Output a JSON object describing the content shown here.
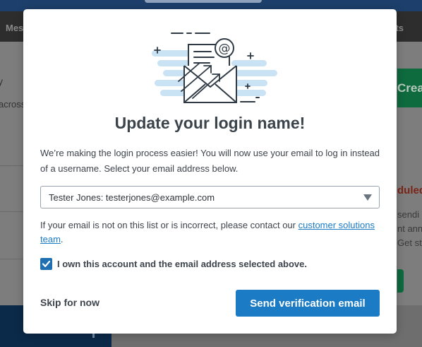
{
  "background": {
    "nav_left": "Mes",
    "nav_right": "ts",
    "left_heading_fragment": "y",
    "left_text_fragment": "across",
    "create_button_fragment": "Crea",
    "right_alert_fragment": "duled",
    "right_lines": [
      "sendi",
      "nt ann",
      "Get sta"
    ]
  },
  "modal": {
    "title": "Update your login name!",
    "description": "We’re making the login process easier! You will now use your email to log in instead of a username. Select your email address below.",
    "email_select": {
      "selected": "Tester Jones: testerjones@example.com"
    },
    "help_prefix": "If your email is not on this list or is incorrect, please contact our ",
    "help_link": "customer solutions team",
    "help_suffix": ".",
    "confirm_checkbox": {
      "checked": true,
      "label": "I own this account and the email address selected above."
    },
    "skip_label": "Skip for now",
    "send_label": "Send verification email"
  },
  "colors": {
    "primary": "#1b7bc4",
    "illustration_cloud": "#c9e3f4",
    "text": "#3d444c"
  },
  "icons": [
    "envelope-email-illustration",
    "chevron-down-icon",
    "checkmark-icon"
  ]
}
